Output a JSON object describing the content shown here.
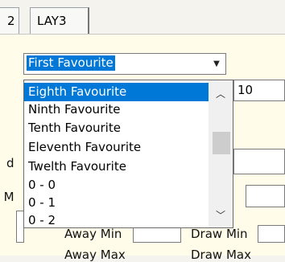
{
  "tabs": [
    {
      "label": "2"
    },
    {
      "label": "LAY3"
    }
  ],
  "combo": {
    "selected_value": "First Favourite"
  },
  "dropdown": {
    "items": [
      {
        "label": "Eighth Favourite",
        "selected": true
      },
      {
        "label": "Ninth Favourite"
      },
      {
        "label": "Tenth Favourite"
      },
      {
        "label": "Eleventh Favourite"
      },
      {
        "label": "Twelth Favourite"
      },
      {
        "label": "0 - 0"
      },
      {
        "label": "0 - 1"
      },
      {
        "label": "0 - 2"
      }
    ]
  },
  "background": {
    "field_value": "10",
    "label_d": "d",
    "label_m": "t M",
    "label_away_min": "Away Min",
    "label_draw_min": "Draw Min",
    "label_away_max": "Away Max",
    "label_draw_max": "Draw Max"
  },
  "colors": {
    "selection": "#0078d7",
    "panel": "#fffde9"
  }
}
